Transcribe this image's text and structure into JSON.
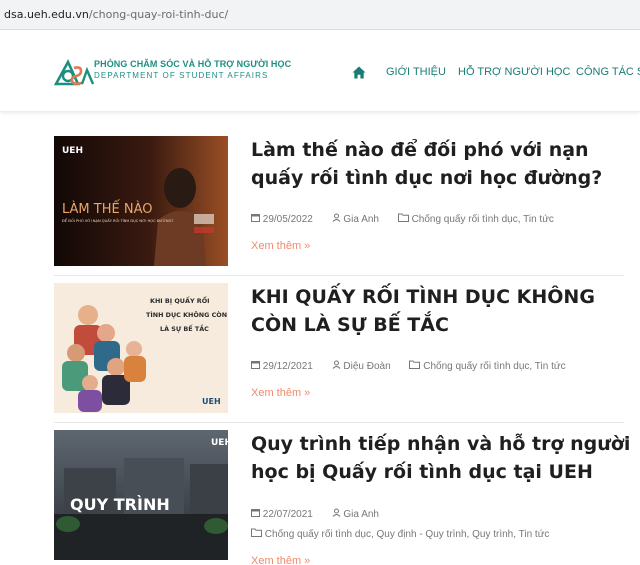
{
  "browser": {
    "url_host": "dsa.ueh.edu.vn",
    "url_path": "/chong-quay-roi-tinh-duc/"
  },
  "header": {
    "logo_mark": "dSA",
    "logo_vn": "PHÒNG CHĂM SÓC VÀ HỖ TRỢ NGƯỜI HỌC",
    "logo_en": "DEPARTMENT OF STUDENT AFFAIRS",
    "nav": {
      "home_icon": "home-icon",
      "items": [
        "GIỚI THIỆU",
        "HỖ TRỢ NGƯỜI HỌC",
        "CÔNG TÁC SI"
      ]
    },
    "accent_color": "#1c8f80"
  },
  "posts": [
    {
      "title": "Làm thế nào để đối phó với nạn quấy rối tình dục nơi học đường?",
      "date": "29/05/2022",
      "author": "Gia Anh",
      "categories": "Chống quấy rối tình dục, Tin tức",
      "more": "Xem thêm »",
      "thumb": {
        "brand": "UEH",
        "headline": "LÀM THẾ NÀO",
        "subline": "ĐỂ ĐỐI PHÓ VỚI NẠN QUẤY RỐI TÌNH DỤC NƠI HỌC ĐƯỜNG?"
      }
    },
    {
      "title": "KHI QUẤY RỐI TÌNH DỤC KHÔNG CÒN LÀ SỰ BẾ TẮC",
      "date": "29/12/2021",
      "author": "Diệu Đoàn",
      "categories": "Chống quấy rối tình dục, Tin tức",
      "more": "Xem thêm »",
      "thumb": {
        "brand": "UEH",
        "line1": "KHI BỊ QUẤY RỐI",
        "line2": "TÌNH DỤC KHÔNG CÒN",
        "line3": "LÀ SỰ BẾ TẮC"
      }
    },
    {
      "title": "Quy trình tiếp nhận và hỗ trợ người học bị Quấy rối tình dục tại UEH",
      "date": "22/07/2021",
      "author": "Gia Anh",
      "categories": "Chống quấy rối tình dục, Quy định - Quy trình, Quy trình, Tin tức",
      "more": "Xem thêm »",
      "thumb": {
        "brand": "UEH",
        "headline": "QUY TRÌNH"
      }
    }
  ],
  "icons": {
    "date": "calendar-icon",
    "author": "user-icon",
    "category": "folder-icon"
  },
  "colors": {
    "link_orange": "#f08a6b",
    "meta_gray": "#777777"
  }
}
